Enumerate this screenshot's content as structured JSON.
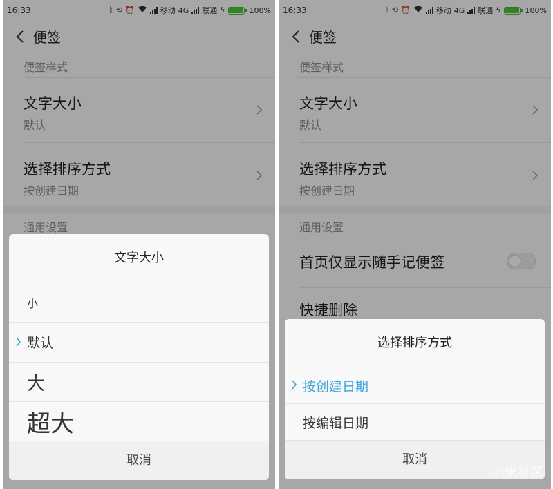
{
  "status_bar": {
    "time": "16:33",
    "carrier1": "移动",
    "network": "4G",
    "carrier2": "联通",
    "battery": "100%"
  },
  "header": {
    "title": "便签"
  },
  "settings": {
    "section_style": "便签样式",
    "font_size_label": "文字大小",
    "font_size_value": "默认",
    "sort_label": "选择排序方式",
    "sort_value": "按创建日期",
    "section_general": "通用设置",
    "home_only_label": "首页仅显示随手记便签",
    "quick_delete_label": "快捷删除"
  },
  "font_dialog": {
    "title": "文字大小",
    "options": [
      {
        "label": "小",
        "selected": false
      },
      {
        "label": "默认",
        "selected": true
      },
      {
        "label": "大",
        "selected": false
      },
      {
        "label": "超大",
        "selected": false
      }
    ],
    "cancel": "取消"
  },
  "sort_dialog": {
    "title": "选择排序方式",
    "options": [
      {
        "label": "按创建日期",
        "selected": true
      },
      {
        "label": "按编辑日期",
        "selected": false
      }
    ],
    "cancel": "取消"
  },
  "watermark": "小米社区",
  "colors": {
    "accent": "#3aa6dc",
    "battery": "#4cc32a"
  },
  "icons": [
    "back-icon",
    "chevron-right-icon",
    "check-icon",
    "bluetooth-icon",
    "alarm-icon",
    "wifi-icon",
    "signal-icon",
    "battery-icon"
  ]
}
